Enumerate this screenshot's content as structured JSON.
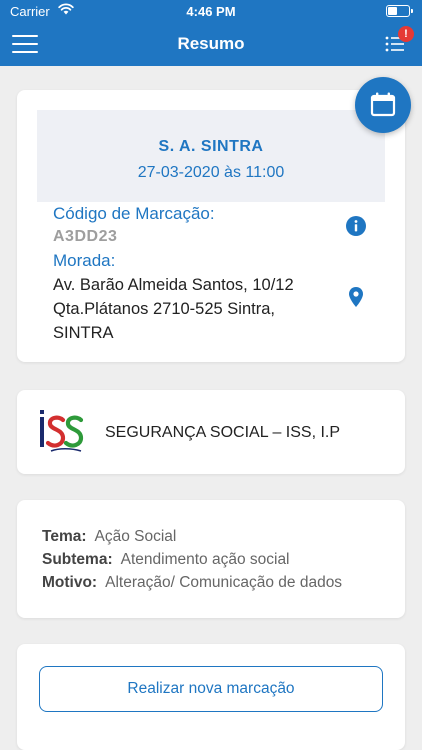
{
  "status_bar": {
    "carrier": "Carrier",
    "time": "4:46 PM"
  },
  "nav": {
    "title": "Resumo",
    "notification_badge": "!",
    "menu_icon": "hamburger-icon",
    "list_icon": "list-icon"
  },
  "appointment": {
    "office_name": "S. A. SINTRA",
    "datetime": "27-03-2020 às 11:00",
    "code_label": "Código de Marcação:",
    "code_value": "A3DD23",
    "address_label": "Morada:",
    "address_lines": [
      "Av. Barão Almeida Santos, 10/12",
      "Qta.Plátanos 2710-525 Sintra,",
      "SINTRA"
    ]
  },
  "entity": {
    "name": "SEGURANÇA SOCIAL – ISS, I.P",
    "logo_text": "ISS"
  },
  "details": {
    "theme_label": "Tema:",
    "theme_value": "Ação Social",
    "subtheme_label": "Subtema:",
    "subtheme_value": "Atendimento ação social",
    "reason_label": "Motivo:",
    "reason_value": "Alteração/ Comunicação de dados"
  },
  "actions": {
    "new_booking_label": "Realizar nova marcação"
  },
  "colors": {
    "primary": "#1f76c2",
    "background": "#eeeeee",
    "badge": "#e53935",
    "logo_red": "#d32f2f",
    "logo_green": "#2e9a3a",
    "logo_navy": "#1a2a6c"
  }
}
